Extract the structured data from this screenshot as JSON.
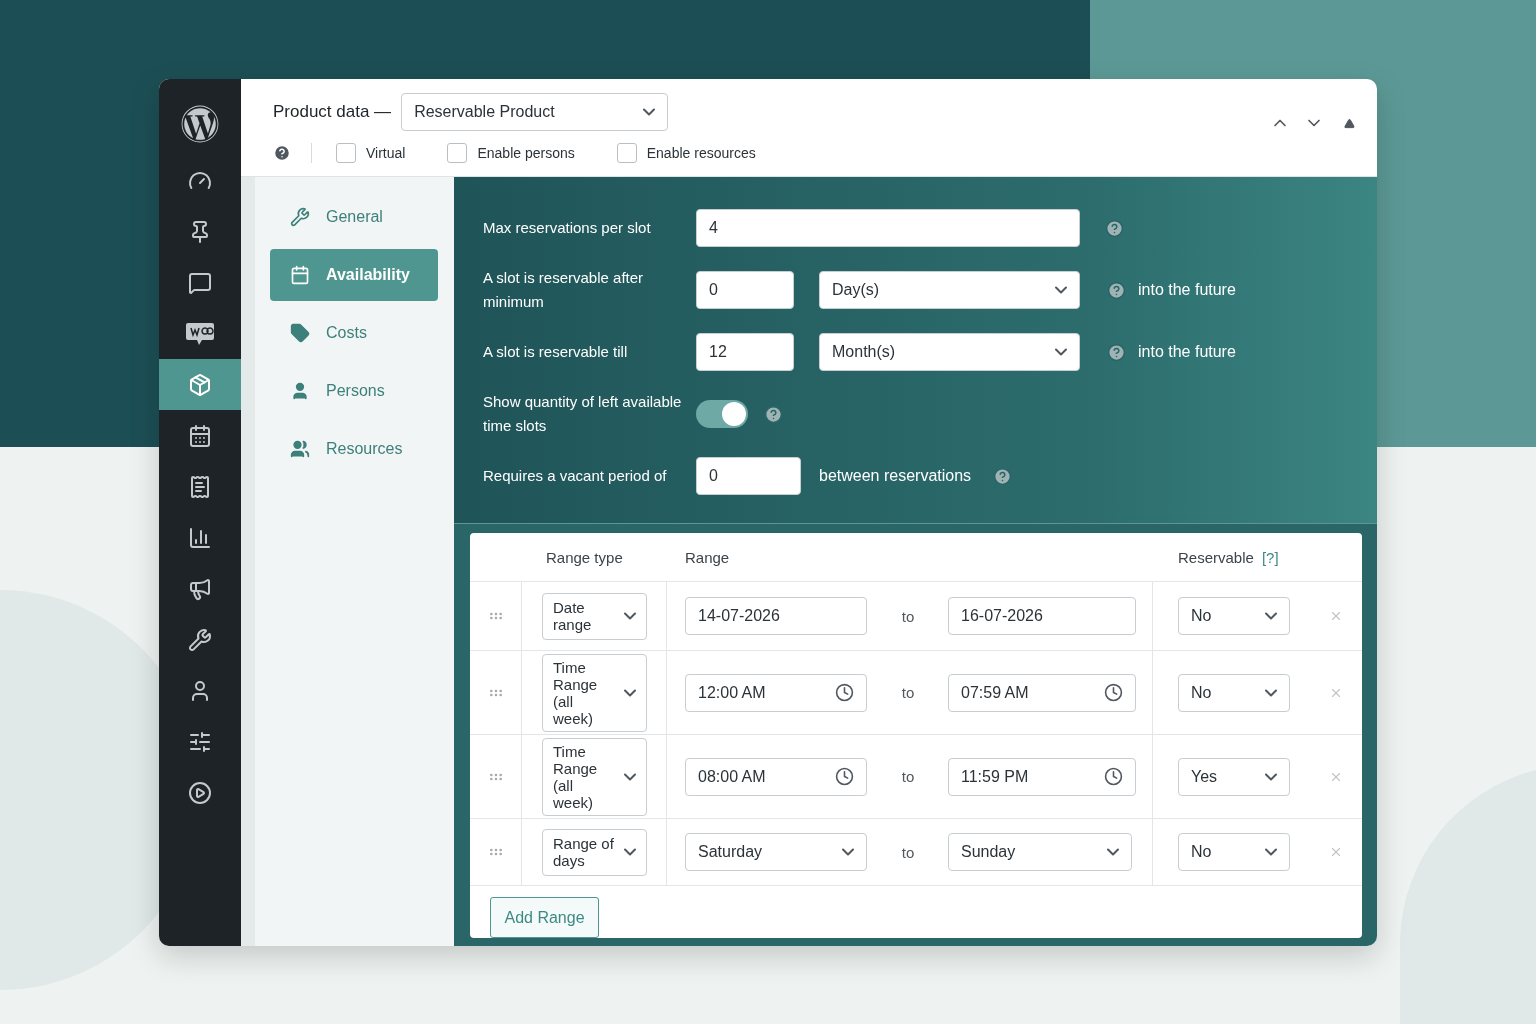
{
  "admin_menu": [
    {
      "selected": false
    },
    {
      "selected": false
    },
    {
      "selected": false
    },
    {
      "selected": false
    },
    {
      "selected": false
    },
    {
      "selected": true
    },
    {
      "selected": false
    },
    {
      "selected": false
    },
    {
      "selected": false
    },
    {
      "selected": false
    },
    {
      "selected": false
    },
    {
      "selected": false
    },
    {
      "selected": false
    },
    {
      "selected": false
    }
  ],
  "header": {
    "title": "Product data —",
    "product_type": "Reservable Product",
    "options": [
      {
        "label": "Virtual",
        "checked": false
      },
      {
        "label": "Enable persons",
        "checked": false
      },
      {
        "label": "Enable resources",
        "checked": false
      }
    ]
  },
  "tabs": [
    {
      "label": "General",
      "selected": false
    },
    {
      "label": "Availability",
      "selected": true
    },
    {
      "label": "Costs",
      "selected": false
    },
    {
      "label": "Persons",
      "selected": false
    },
    {
      "label": "Resources",
      "selected": false
    }
  ],
  "settings": [
    {
      "kind": "text",
      "label": "Max reservations per slot",
      "value": "4"
    },
    {
      "kind": "number_unit",
      "label": "A slot is reservable after minimum",
      "value": "0",
      "unit": "Day(s)",
      "suffix": "into the future"
    },
    {
      "kind": "number_unit",
      "label": "A slot is reservable till",
      "value": "12",
      "unit": "Month(s)",
      "suffix": "into the future"
    },
    {
      "kind": "toggle",
      "label": "Show quantity of left available time slots",
      "on": true
    },
    {
      "kind": "number_suffix",
      "label": "Requires a vacant period of",
      "value": "0",
      "suffix": "between reservations"
    }
  ],
  "table": {
    "columns": [
      "Range type",
      "Range",
      "Reservable"
    ],
    "help_link": "[?]",
    "rows": [
      {
        "kind": "date",
        "type": "Date range",
        "from": "14-07-2026",
        "connector": "to",
        "to": "16-07-2026",
        "reservable": "No"
      },
      {
        "kind": "time",
        "type": "Time Range (all week)",
        "from": "12:00 AM",
        "connector": "to",
        "to": "07:59 AM",
        "reservable": "No"
      },
      {
        "kind": "time",
        "type": "Time Range (all week)",
        "from": "08:00 AM",
        "connector": "to",
        "to": "11:59 PM",
        "reservable": "Yes"
      },
      {
        "kind": "days",
        "type": "Range of days",
        "from": "Saturday",
        "connector": "to",
        "to": "Sunday",
        "reservable": "No"
      }
    ],
    "add_button": "Add Range"
  }
}
